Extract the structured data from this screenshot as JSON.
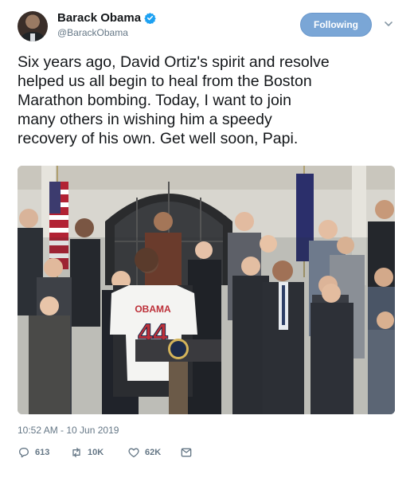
{
  "user": {
    "display_name": "Barack Obama",
    "handle": "@BarackObama",
    "verified": true
  },
  "follow_button": {
    "label": "Following"
  },
  "tweet": {
    "text": "Six years ago, David Ortiz's spirit and resolve\nhelped us all begin to heal from the Boston\nMarathon bombing. Today, I want to join\nmany others in wishing him a speedy\nrecovery of his own. Get well soon, Papi.",
    "timestamp": "10:52 AM - 10 Jun 2019"
  },
  "photo": {
    "jersey_name": "OBAMA",
    "jersey_number": "44"
  },
  "actions": {
    "replies": "613",
    "retweets": "10K",
    "likes": "62K"
  },
  "colors": {
    "accent": "#1da1f2",
    "follow_bg": "#7aa6d6",
    "muted": "#657786"
  },
  "icons": [
    "verified-icon",
    "chevron-down-icon",
    "reply-icon",
    "retweet-icon",
    "like-icon",
    "dm-icon"
  ]
}
